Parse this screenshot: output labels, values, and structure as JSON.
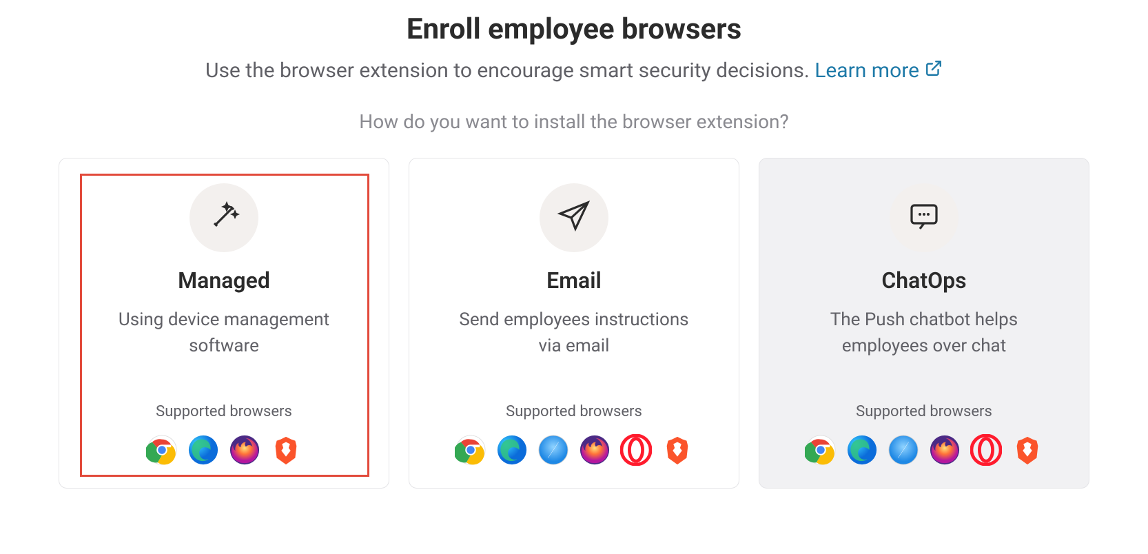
{
  "header": {
    "title": "Enroll employee browsers",
    "subtitle": "Use the browser extension to encourage smart security decisions.",
    "learn_more": "Learn more",
    "question": "How do you want to install the browser extension?"
  },
  "cards": [
    {
      "id": "managed",
      "title": "Managed",
      "description": "Using device management software",
      "supported_label": "Supported browsers",
      "browsers": [
        "chrome",
        "edge",
        "firefox",
        "brave"
      ],
      "highlighted": true,
      "disabled": false,
      "icon": "magic-wand"
    },
    {
      "id": "email",
      "title": "Email",
      "description": "Send employees instructions via email",
      "supported_label": "Supported browsers",
      "browsers": [
        "chrome",
        "edge",
        "safari",
        "firefox",
        "opera",
        "brave"
      ],
      "highlighted": false,
      "disabled": false,
      "icon": "paper-plane"
    },
    {
      "id": "chatops",
      "title": "ChatOps",
      "description": "The Push chatbot helps employees over chat",
      "supported_label": "Supported browsers",
      "browsers": [
        "chrome",
        "edge",
        "safari",
        "firefox",
        "opera",
        "brave"
      ],
      "highlighted": false,
      "disabled": true,
      "icon": "chat-bubble"
    }
  ]
}
